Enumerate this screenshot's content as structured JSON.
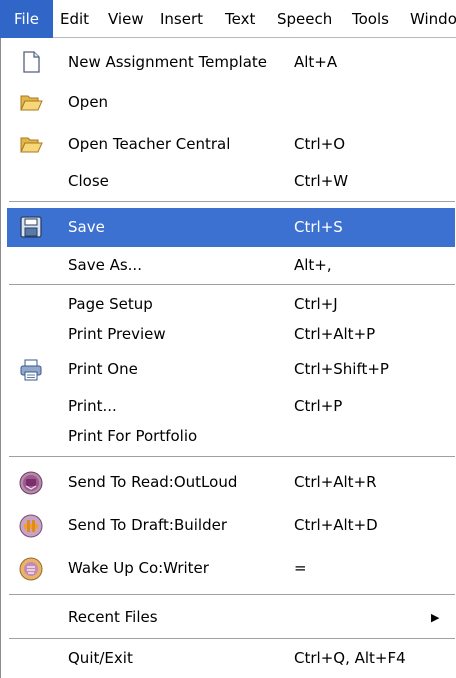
{
  "menubar": {
    "items": [
      "File",
      "Edit",
      "View",
      "Insert",
      "Text",
      "Speech",
      "Tools",
      "Windo"
    ]
  },
  "menu": {
    "items": {
      "new_template": {
        "label": "New Assignment Template",
        "shortcut": "Alt+A",
        "icon": "new-document-icon"
      },
      "open": {
        "label": "Open",
        "shortcut": "",
        "icon": "folder-open-icon"
      },
      "open_teacher": {
        "label": "Open Teacher Central",
        "shortcut": "Ctrl+O",
        "icon": "folder-open-icon"
      },
      "close": {
        "label": "Close",
        "shortcut": "Ctrl+W"
      },
      "save": {
        "label": "Save",
        "shortcut": "Ctrl+S",
        "icon": "floppy-disk-icon"
      },
      "save_as": {
        "label": "Save As...",
        "shortcut": "Alt+,"
      },
      "page_setup": {
        "label": "Page Setup",
        "shortcut": "Ctrl+J"
      },
      "print_preview": {
        "label": "Print Preview",
        "shortcut": "Ctrl+Alt+P"
      },
      "print_one": {
        "label": "Print One",
        "shortcut": "Ctrl+Shift+P",
        "icon": "printer-icon"
      },
      "print": {
        "label": "Print...",
        "shortcut": "Ctrl+P"
      },
      "print_portfolio": {
        "label": "Print For Portfolio",
        "shortcut": ""
      },
      "send_read": {
        "label": "Send To Read:OutLoud",
        "shortcut": "Ctrl+Alt+R",
        "icon": "read-outloud-icon"
      },
      "send_draft": {
        "label": "Send To Draft:Builder",
        "shortcut": "Ctrl+Alt+D",
        "icon": "draft-builder-icon"
      },
      "wake_up": {
        "label": "Wake Up Co:Writer",
        "shortcut": "=",
        "icon": "co-writer-icon"
      },
      "recent": {
        "label": "Recent Files",
        "shortcut": ""
      },
      "quit": {
        "label": "Quit/Exit",
        "shortcut": "Ctrl+Q, Alt+F4"
      }
    }
  },
  "colors": {
    "highlight": "#3d71d1",
    "menubar_active": "#2f66c8"
  }
}
